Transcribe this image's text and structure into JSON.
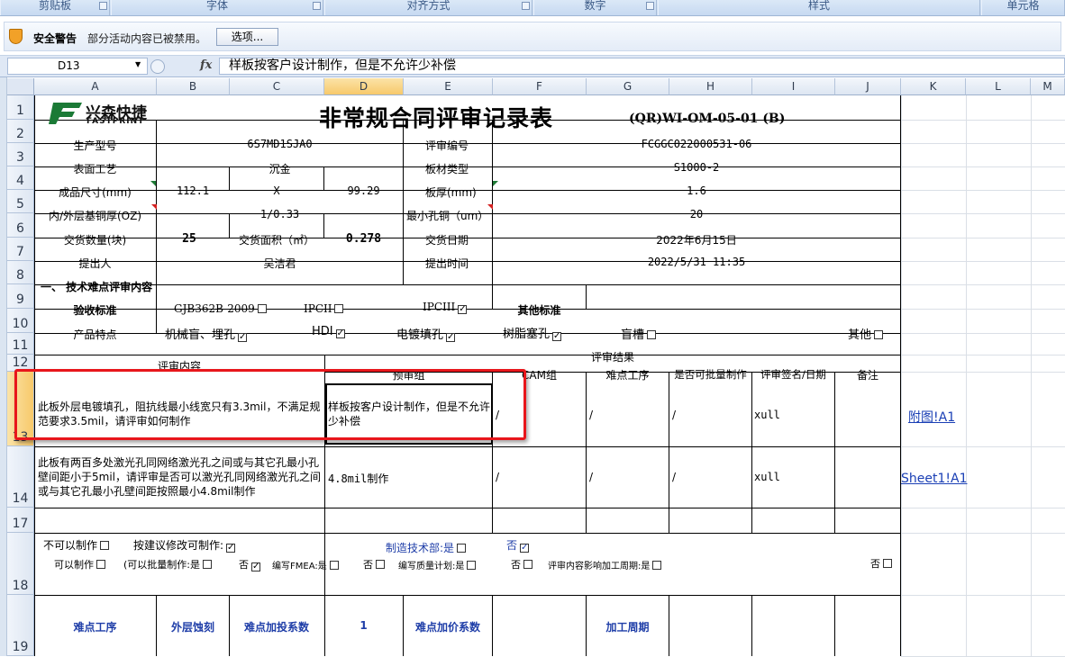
{
  "ribbon": {
    "groups": [
      "剪贴板",
      "字体",
      "对齐方式",
      "数字",
      "样式",
      "单元格"
    ]
  },
  "security": {
    "title": "安全警告",
    "message": "部分活动内容已被禁用。",
    "options_button": "选项..."
  },
  "formula_bar": {
    "name_box": "D13",
    "fx": "fx",
    "content": "样板按客户设计制作，但是不允许少补偿"
  },
  "columns": [
    "A",
    "B",
    "C",
    "D",
    "E",
    "F",
    "G",
    "H",
    "I",
    "J",
    "K",
    "L",
    "M"
  ],
  "rows": [
    "1",
    "2",
    "3",
    "4",
    "5",
    "6",
    "7",
    "8",
    "9",
    "10",
    "11",
    "12",
    "13",
    "14",
    "17",
    "18",
    "19"
  ],
  "sheet": {
    "logo_cn": "兴森快捷",
    "logo_en": "FASTPRINT",
    "title": "非常规合同评审记录表",
    "doc_code": "(QR)WI-OM-05-01 (B)",
    "r2": {
      "a": "生产型号",
      "b": "6S7MD1SJA0",
      "e": "评审编号",
      "f": "FCGGC022000531-06"
    },
    "r3": {
      "a": "表面工艺",
      "b": "沉金",
      "e": "板材类型",
      "f": "S1000-2"
    },
    "r4": {
      "a": "成品尺寸(mm)",
      "b": "112.1",
      "c": "X",
      "d": "99.29",
      "e": "板厚(mm)",
      "f": "1.6"
    },
    "r5": {
      "a": "内/外层基铜厚(OZ)",
      "b": "1/0.33",
      "e": "最小孔铜（um）",
      "f": "20"
    },
    "r6": {
      "a": "交货数量(块)",
      "b": "25",
      "c": "交货面积（㎡）",
      "d": "0.278",
      "e": "交货日期",
      "f": "2022年6月15日"
    },
    "r7": {
      "a": "提出人",
      "b": "吴洁君",
      "e": "提出时间",
      "f": "2022/5/31 11:35"
    },
    "r8": {
      "a": "一、 技术难点评审内容"
    },
    "r9": {
      "a": "验收标准",
      "s1": "GJB362B-2009",
      "s2": "IPCII",
      "s3": "IPCIII",
      "f": "其他标准"
    },
    "r10": {
      "a": "产品特点",
      "p1": "机械盲、埋孔",
      "p2": "HDI",
      "p3": "电镀填孔",
      "p4": "树脂塞孔",
      "p5": "盲槽",
      "p6": "其他"
    },
    "r11": {
      "a": "评审内容",
      "d": "评审结果"
    },
    "r12": {
      "d": "预审组",
      "f": "CAM组",
      "g": "难点工序",
      "h": "是否可批量制作",
      "i": "评审签名/日期",
      "j": "备注"
    },
    "r13": {
      "a": "此板外层电镀填孔，阻抗线最小线宽只有3.3mil，不满足规范要求3.5mil，请评审如何制作",
      "d": "样板按客户设计制作，但是不允许少补偿",
      "f": "/",
      "g": "/",
      "h": "/",
      "i": "xull",
      "k": "附图!A1"
    },
    "r14": {
      "a": "此板有两百多处激光孔同网络激光孔之间或与其它孔最小孔壁间距小于5mil，请评审是否可以激光孔同网络激光孔之间或与其它孔最小孔壁间距按照最小4.8mil制作",
      "d": "4.8mil制作",
      "f": "/",
      "g": "/",
      "h": "/",
      "i": "xull",
      "k": "Sheet1!A1"
    },
    "r18": {
      "l1a": "不可以制作",
      "l1b": "按建议修改可制作:",
      "l1c": "制造技术部:是",
      "l1d": "否",
      "l2a": "可以制作",
      "l2b": "(可以批量制作:是",
      "l2c": "否",
      "l2d": "编写FMEA:是",
      "l2e": "否",
      "l2f": "编写质量计划:是",
      "l2g": "否",
      "l2h": "评审内容影响加工周期:是",
      "l2i": "否"
    },
    "r19": {
      "a": "难点工序",
      "b": "外层蚀刻",
      "c": "难点加投系数",
      "d": "1",
      "e": "难点加价系数",
      "g": "加工周期"
    }
  },
  "checkbox_states": {
    "gjb": false,
    "ipc2": false,
    "ipc3": true,
    "mech": true,
    "hdi": true,
    "fill": true,
    "resin": true,
    "slot": false,
    "other": false,
    "cannot": false,
    "suggest": true,
    "mfg_yes": false,
    "mfg_no": true,
    "can": false,
    "batch_yes": false,
    "batch_no": true,
    "fmea_yes": false,
    "fmea_no": false,
    "qp_yes": false,
    "qp_no": false,
    "cycle_yes": false,
    "last_no": false
  },
  "colors": {
    "accent_highlight": "#f7c96b",
    "annotation_red": "#e8161b",
    "link": "#1a3fb5",
    "ribbon": "#c6d9f1"
  }
}
